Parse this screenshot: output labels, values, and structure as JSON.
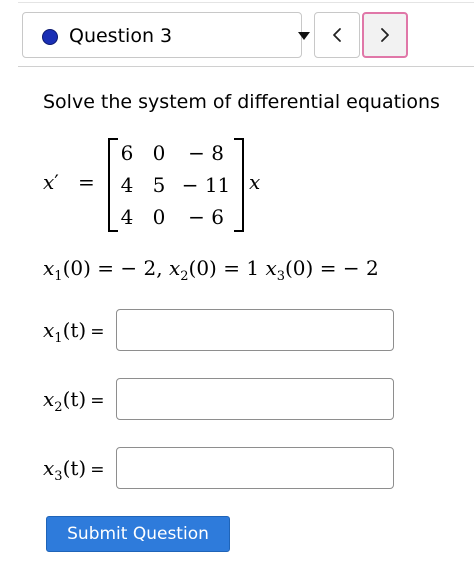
{
  "header": {
    "question_label": "Question 3",
    "status_color": "#1a2fb5",
    "prev_icon": "chevron-left-icon",
    "next_icon": "chevron-right-icon",
    "next_border_color": "#e077a8"
  },
  "problem": {
    "prompt": "Solve the system of differential equations",
    "lhs_var": "x",
    "lhs_prime": "′",
    "equals": "=",
    "rhs_var": "x",
    "matrix": [
      [
        "6",
        "0",
        "− 8"
      ],
      [
        "4",
        "5",
        "− 11"
      ],
      [
        "4",
        "0",
        "− 6"
      ]
    ]
  },
  "initial_conditions": [
    {
      "var": "x",
      "sub": "1",
      "arg": "(0)",
      "eq": " = ",
      "value": "− 2",
      "sep": ",  "
    },
    {
      "var": "x",
      "sub": "2",
      "arg": "(0)",
      "eq": " = ",
      "value": "1",
      "sep": " "
    },
    {
      "var": "x",
      "sub": "3",
      "arg": "(0)",
      "eq": " = ",
      "value": "− 2",
      "sep": ""
    }
  ],
  "answers": [
    {
      "var": "x",
      "sub": "1",
      "arg": "(t)",
      "eq": "=",
      "value": ""
    },
    {
      "var": "x",
      "sub": "2",
      "arg": "(t)",
      "eq": "=",
      "value": ""
    },
    {
      "var": "x",
      "sub": "3",
      "arg": "(t)",
      "eq": "=",
      "value": ""
    }
  ],
  "submit_label": "Submit Question"
}
